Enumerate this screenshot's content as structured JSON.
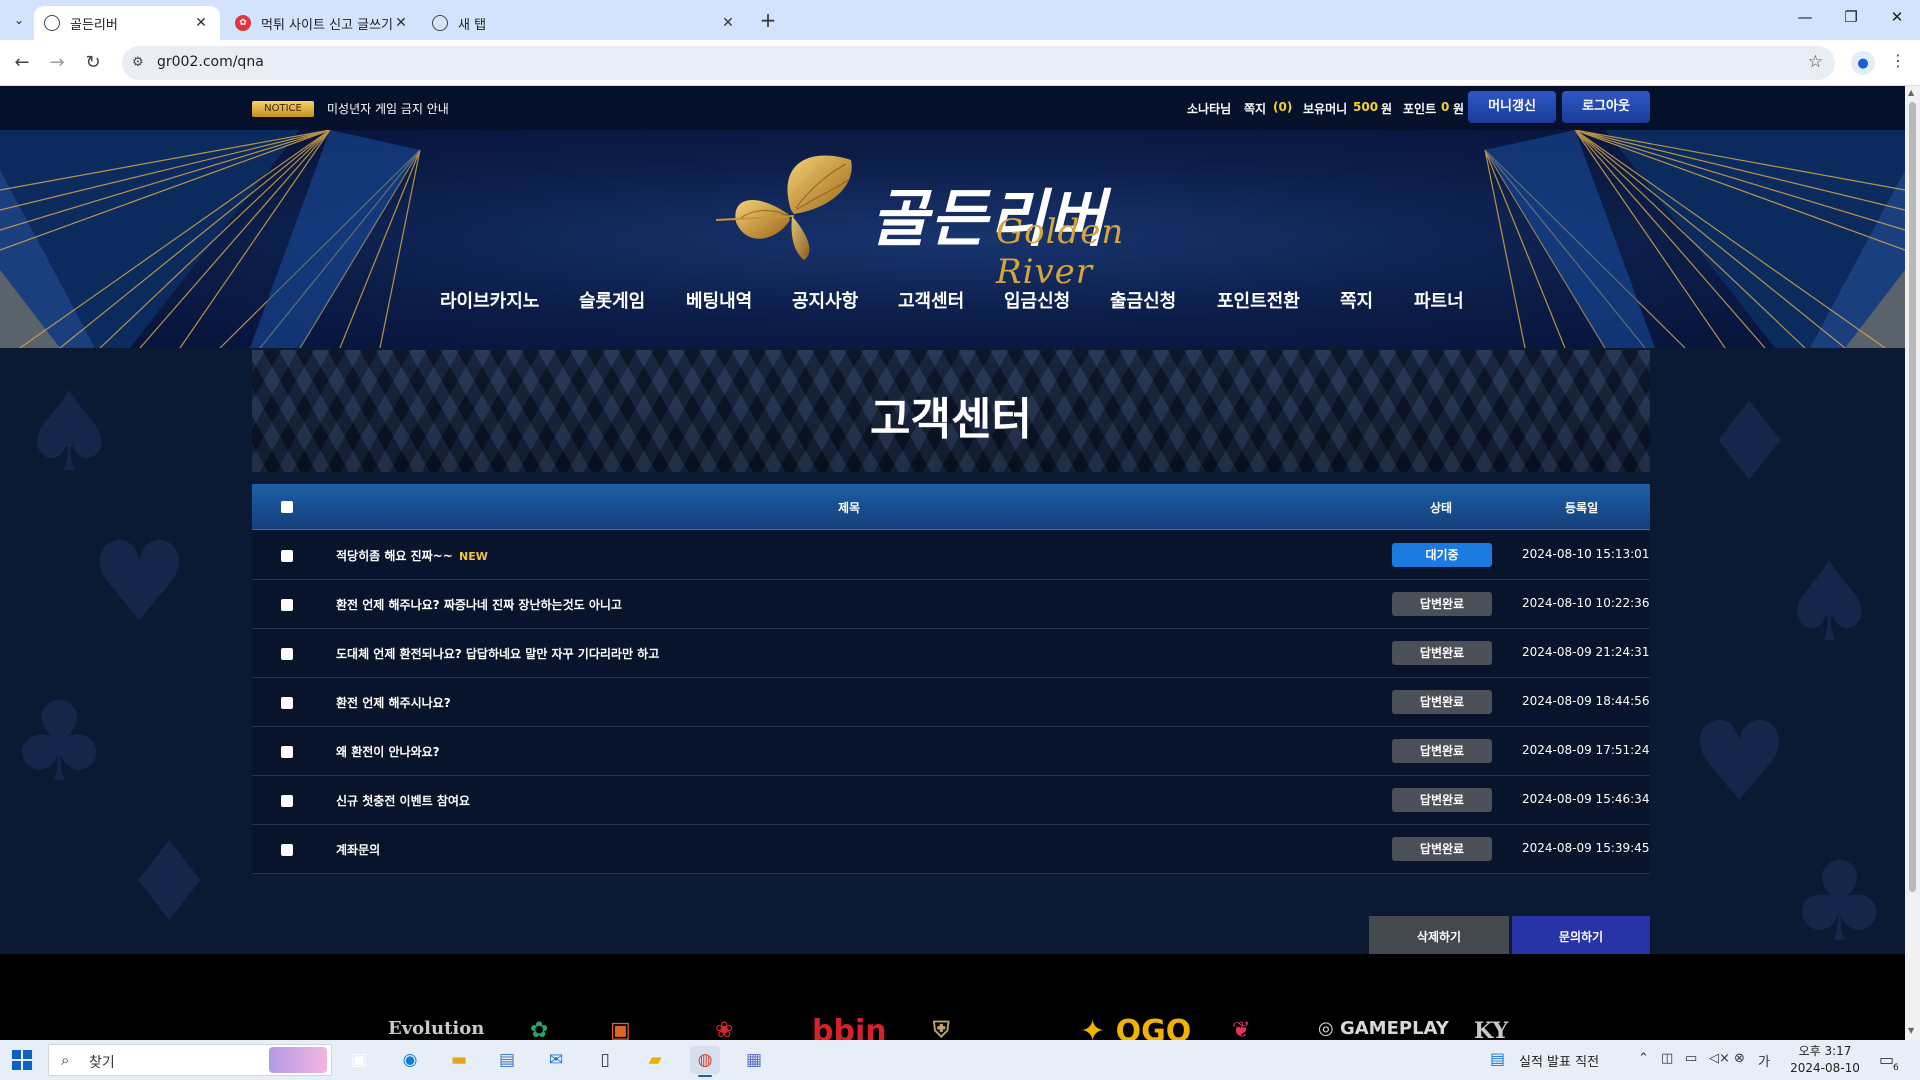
{
  "browser": {
    "tabs": [
      {
        "title": "골든리버",
        "active": true,
        "favicon": "globe-icon"
      },
      {
        "title": "먹튀 사이트 신고 글쓰기 | 토토",
        "active": false,
        "favicon": "red-flower-icon"
      },
      {
        "title": "새 탭",
        "active": false,
        "favicon": "globe-icon"
      }
    ],
    "url": "gr002.com/qna"
  },
  "site": {
    "notice_badge": "NOTICE",
    "notice_text": "미성년자 게임 금지 안내",
    "user": {
      "name": "소나타님",
      "message_label": "쪽지",
      "message_count": "(0)",
      "money_label": "보유머니",
      "money_value": "500",
      "money_unit": "원",
      "point_label": "포인트",
      "point_value": "0",
      "point_unit": "원"
    },
    "buttons": {
      "money_refresh": "머니갱신",
      "logout": "로그아웃"
    },
    "logo": {
      "main": "골든리버",
      "sub": "Golden River"
    },
    "nav": [
      "라이브카지노",
      "슬롯게임",
      "베팅내역",
      "공지사항",
      "고객센터",
      "입금신청",
      "출금신청",
      "포인트전환",
      "쪽지",
      "파트너"
    ]
  },
  "page": {
    "title": "고객센터",
    "table": {
      "headers": {
        "title": "제목",
        "status": "상태",
        "date": "등록일"
      },
      "rows": [
        {
          "title": "적당히좀 해요 진짜~~",
          "new": "NEW",
          "status": "대기중",
          "status_type": "waiting",
          "date": "2024-08-10 15:13:01"
        },
        {
          "title": "환전 언제 해주나요? 짜증나네 진짜 장난하는것도 아니고",
          "new": "",
          "status": "답변완료",
          "status_type": "done",
          "date": "2024-08-10 10:22:36"
        },
        {
          "title": "도대체 언제 환전되나요? 답답하네요 말만 자꾸 기다리라만 하고",
          "new": "",
          "status": "답변완료",
          "status_type": "done",
          "date": "2024-08-09 21:24:31"
        },
        {
          "title": "환전 언제 해주시나요?",
          "new": "",
          "status": "답변완료",
          "status_type": "done",
          "date": "2024-08-09 18:44:56"
        },
        {
          "title": "왜 환전이 안나와요?",
          "new": "",
          "status": "답변완료",
          "status_type": "done",
          "date": "2024-08-09 17:51:24"
        },
        {
          "title": "신규 첫충전 이벤트 참여요",
          "new": "",
          "status": "답변완료",
          "status_type": "done",
          "date": "2024-08-09 15:46:34"
        },
        {
          "title": "계좌문의",
          "new": "",
          "status": "답변완료",
          "status_type": "done",
          "date": "2024-08-09 15:39:45"
        }
      ]
    },
    "buttons": {
      "delete": "삭제하기",
      "ask": "문의하기"
    }
  },
  "footer_vendors": [
    {
      "name": "Evolution",
      "color": "#c9c9c9"
    },
    {
      "name": "✿",
      "color": "#29a36b"
    },
    {
      "name": "▣",
      "color": "#e0632a"
    },
    {
      "name": "❀",
      "color": "#d62828"
    },
    {
      "name": "bbin",
      "color": "#d6202a"
    },
    {
      "name": "⛨",
      "color": "#bfa470"
    },
    {
      "name": "✦ OGO",
      "color": "#f0b400"
    },
    {
      "name": "❦",
      "color": "#e2345b"
    },
    {
      "name": "◎ GAMEPLAY",
      "color": "#d8d8d8"
    },
    {
      "name": "KY",
      "color": "#c8c8c8"
    }
  ],
  "taskbar": {
    "search_placeholder": "찾기",
    "widget_text": "실적 발표 직전",
    "time": "오후 3:17",
    "date": "2024-08-10",
    "notification_count": "6"
  },
  "colors": {
    "nav_blue": "#1d5fa8",
    "status_waiting": "#1b7ae0",
    "status_done": "#4b4f57",
    "ask_button": "#2734a8",
    "highlight_yellow": "#f3d22b"
  }
}
